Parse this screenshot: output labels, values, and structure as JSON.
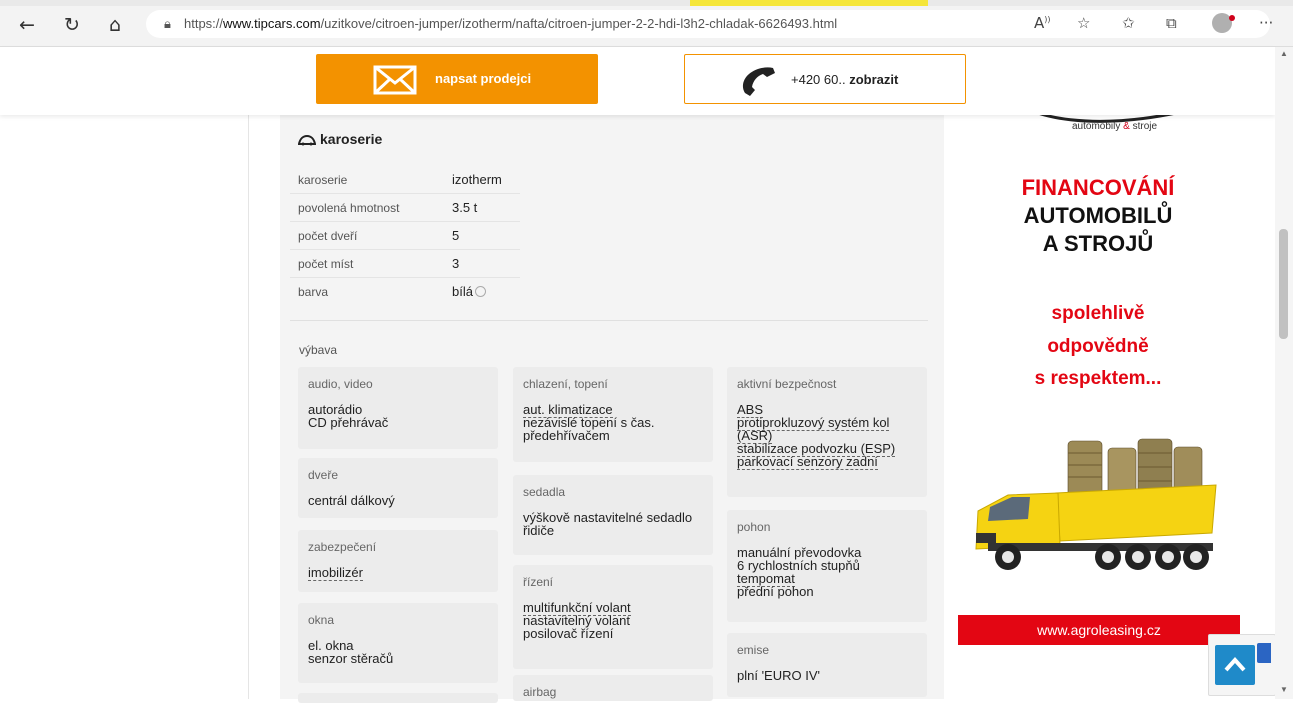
{
  "browser": {
    "url_prefix": "https://",
    "url_host": "www.tipcars.com",
    "url_path": "/uzitkove/citroen-jumper/izotherm/nafta/citroen-jumper-2-2-hdi-l3h2-chladak-6626493.html"
  },
  "contact": {
    "write_label": "napsat prodejci",
    "phone_prefix": "+420 60..",
    "phone_reveal": "zobrazit"
  },
  "body_section": {
    "title": "karoserie",
    "rows": [
      {
        "key": "karoserie",
        "value": "izotherm"
      },
      {
        "key": "povolená hmotnost",
        "value": "3.5 t"
      },
      {
        "key": "počet dveří",
        "value": "5"
      },
      {
        "key": "počet míst",
        "value": "3"
      },
      {
        "key": "barva",
        "value": "bílá"
      }
    ]
  },
  "equipment": {
    "title": "výbava",
    "col1": [
      {
        "heading": "audio, video",
        "items": [
          "autorádio",
          "CD přehrávač"
        ]
      },
      {
        "heading": "dveře",
        "items": [
          "centrál dálkový"
        ]
      },
      {
        "heading": "zabezpečení",
        "items": [
          "imobilizér"
        ]
      },
      {
        "heading": "okna",
        "items": [
          "el. okna",
          "senzor stěračů"
        ]
      }
    ],
    "col2": [
      {
        "heading": "chlazení, topení",
        "items": [
          "aut. klimatizace",
          "nezávislé topení s čas. předehřívačem"
        ]
      },
      {
        "heading": "sedadla",
        "items": [
          "výškově nastavitelné sedadlo řidiče"
        ]
      },
      {
        "heading": "řízení",
        "items": [
          "multifunkční volant",
          "nastavitelný volant",
          "posilovač řízení"
        ]
      },
      {
        "heading": "airbag",
        "items": []
      }
    ],
    "col3": [
      {
        "heading": "aktivní bezpečnost",
        "items": [
          "ABS",
          "protiprokluzový systém kol (ASR)",
          "stabilizace podvozku (ESP)",
          "parkovací senzory zadní"
        ]
      },
      {
        "heading": "pohon",
        "items": [
          "manuální převodovka",
          "6 rychlostních stupňů",
          "tempomat",
          "přední pohon"
        ]
      },
      {
        "heading": "emise",
        "items": [
          "plní 'EURO IV'"
        ]
      }
    ]
  },
  "ad": {
    "slogan_a": "automobily",
    "slogan_amp": "&",
    "slogan_b": "stroje",
    "line1": "FINANCOVÁNÍ",
    "line2": "AUTOMOBILŮ",
    "line3": "A STROJŮ",
    "line4": "spolehlivě",
    "line5": "odpovědně",
    "line6": "s respektem...",
    "url": "www.agroleasing.cz"
  },
  "colors": {
    "accent": "#f39200",
    "ad_red": "#e30613",
    "panel": "#f4f4f4"
  }
}
